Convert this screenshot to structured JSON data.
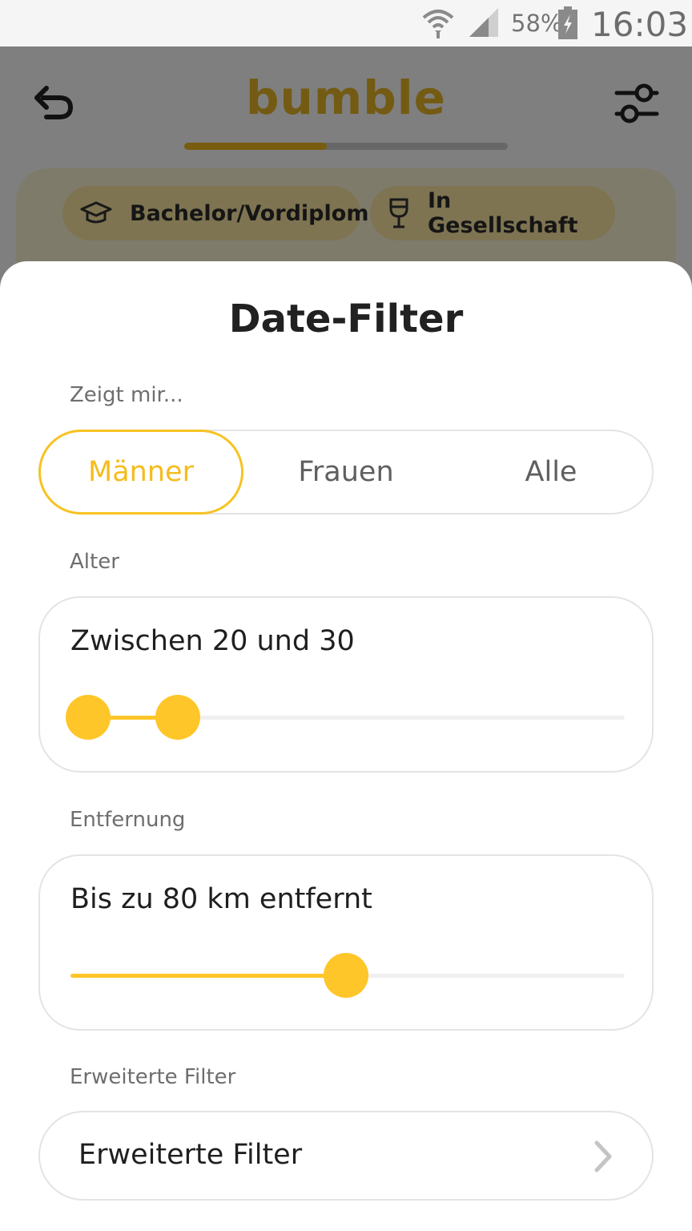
{
  "status_bar": {
    "battery_percent": "58%",
    "time": "16:03"
  },
  "app": {
    "brand": "bumble",
    "progress": 0.44,
    "chips": [
      {
        "label": "Bachelor/Vordiplom",
        "icon": "graduation-cap-icon"
      },
      {
        "label": "In Gesellschaft",
        "icon": "wine-glass-icon"
      }
    ]
  },
  "sheet": {
    "title": "Date-Filter",
    "show_label": "Zeigt mir...",
    "genders": [
      "Männer",
      "Frauen",
      "Alle"
    ],
    "selected_gender": "Männer",
    "age_label": "Alter",
    "age_text": "Zwischen 20 und 30",
    "age_range": {
      "min": 18,
      "max": 80,
      "low": 20,
      "high": 30
    },
    "distance_label": "Entfernung",
    "distance_text": "Bis zu 80 km entfernt",
    "distance": {
      "min": 1,
      "max": 160,
      "value": 80
    },
    "advanced_label": "Erweiterte Filter",
    "advanced_row_label": "Erweiterte Filter"
  },
  "colors": {
    "accent": "#ffc629",
    "selected_text": "#f5bc1c"
  }
}
